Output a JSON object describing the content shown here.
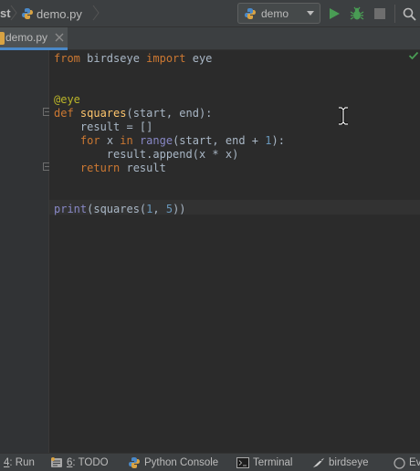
{
  "navbar": {
    "project_crumb": "st",
    "file_crumb": "demo.py"
  },
  "toolbar": {
    "run_config": "demo",
    "colors": {
      "run": "#499c54",
      "debug": "#499c54",
      "stop": "#6e6e6e"
    }
  },
  "tabs": [
    {
      "label": "demo.py",
      "active": true
    }
  ],
  "editor": {
    "lines": [
      [
        {
          "t": "from ",
          "c": "kw"
        },
        {
          "t": "birdseye ",
          "c": ""
        },
        {
          "t": "import ",
          "c": "kw"
        },
        {
          "t": "eye",
          "c": ""
        }
      ],
      [],
      [],
      [
        {
          "t": "@eye",
          "c": "deco"
        }
      ],
      [
        {
          "t": "def ",
          "c": "kw"
        },
        {
          "t": "squares",
          "c": "fn"
        },
        {
          "t": "(start, end):",
          "c": ""
        }
      ],
      [
        {
          "t": "    result = []",
          "c": ""
        }
      ],
      [
        {
          "t": "    ",
          "c": ""
        },
        {
          "t": "for ",
          "c": "kw"
        },
        {
          "t": "x ",
          "c": ""
        },
        {
          "t": "in ",
          "c": "kw"
        },
        {
          "t": "range",
          "c": "bi"
        },
        {
          "t": "(start, end + ",
          "c": ""
        },
        {
          "t": "1",
          "c": "num"
        },
        {
          "t": "):",
          "c": ""
        }
      ],
      [
        {
          "t": "        result.append(x * x)",
          "c": ""
        }
      ],
      [
        {
          "t": "    ",
          "c": ""
        },
        {
          "t": "return ",
          "c": "kw"
        },
        {
          "t": "result",
          "c": ""
        }
      ],
      [],
      [],
      [
        {
          "t": "print",
          "c": "bi"
        },
        {
          "t": "(squares(",
          "c": ""
        },
        {
          "t": "1",
          "c": "num"
        },
        {
          "t": ", ",
          "c": ""
        },
        {
          "t": "5",
          "c": "num"
        },
        {
          "t": "))",
          "c": ""
        }
      ]
    ]
  },
  "bottom_tools": [
    {
      "num": "4",
      "label": ": Run",
      "icon": "run-icon"
    },
    {
      "num": "6",
      "label": ": TODO",
      "icon": "todo-icon"
    },
    {
      "label": "Python Console",
      "icon": "python-console-icon"
    },
    {
      "label": "Terminal",
      "icon": "terminal-icon"
    },
    {
      "label": "birdseye",
      "icon": "birdseye-icon"
    },
    {
      "label": "Ev",
      "icon": "event-log-icon"
    }
  ]
}
